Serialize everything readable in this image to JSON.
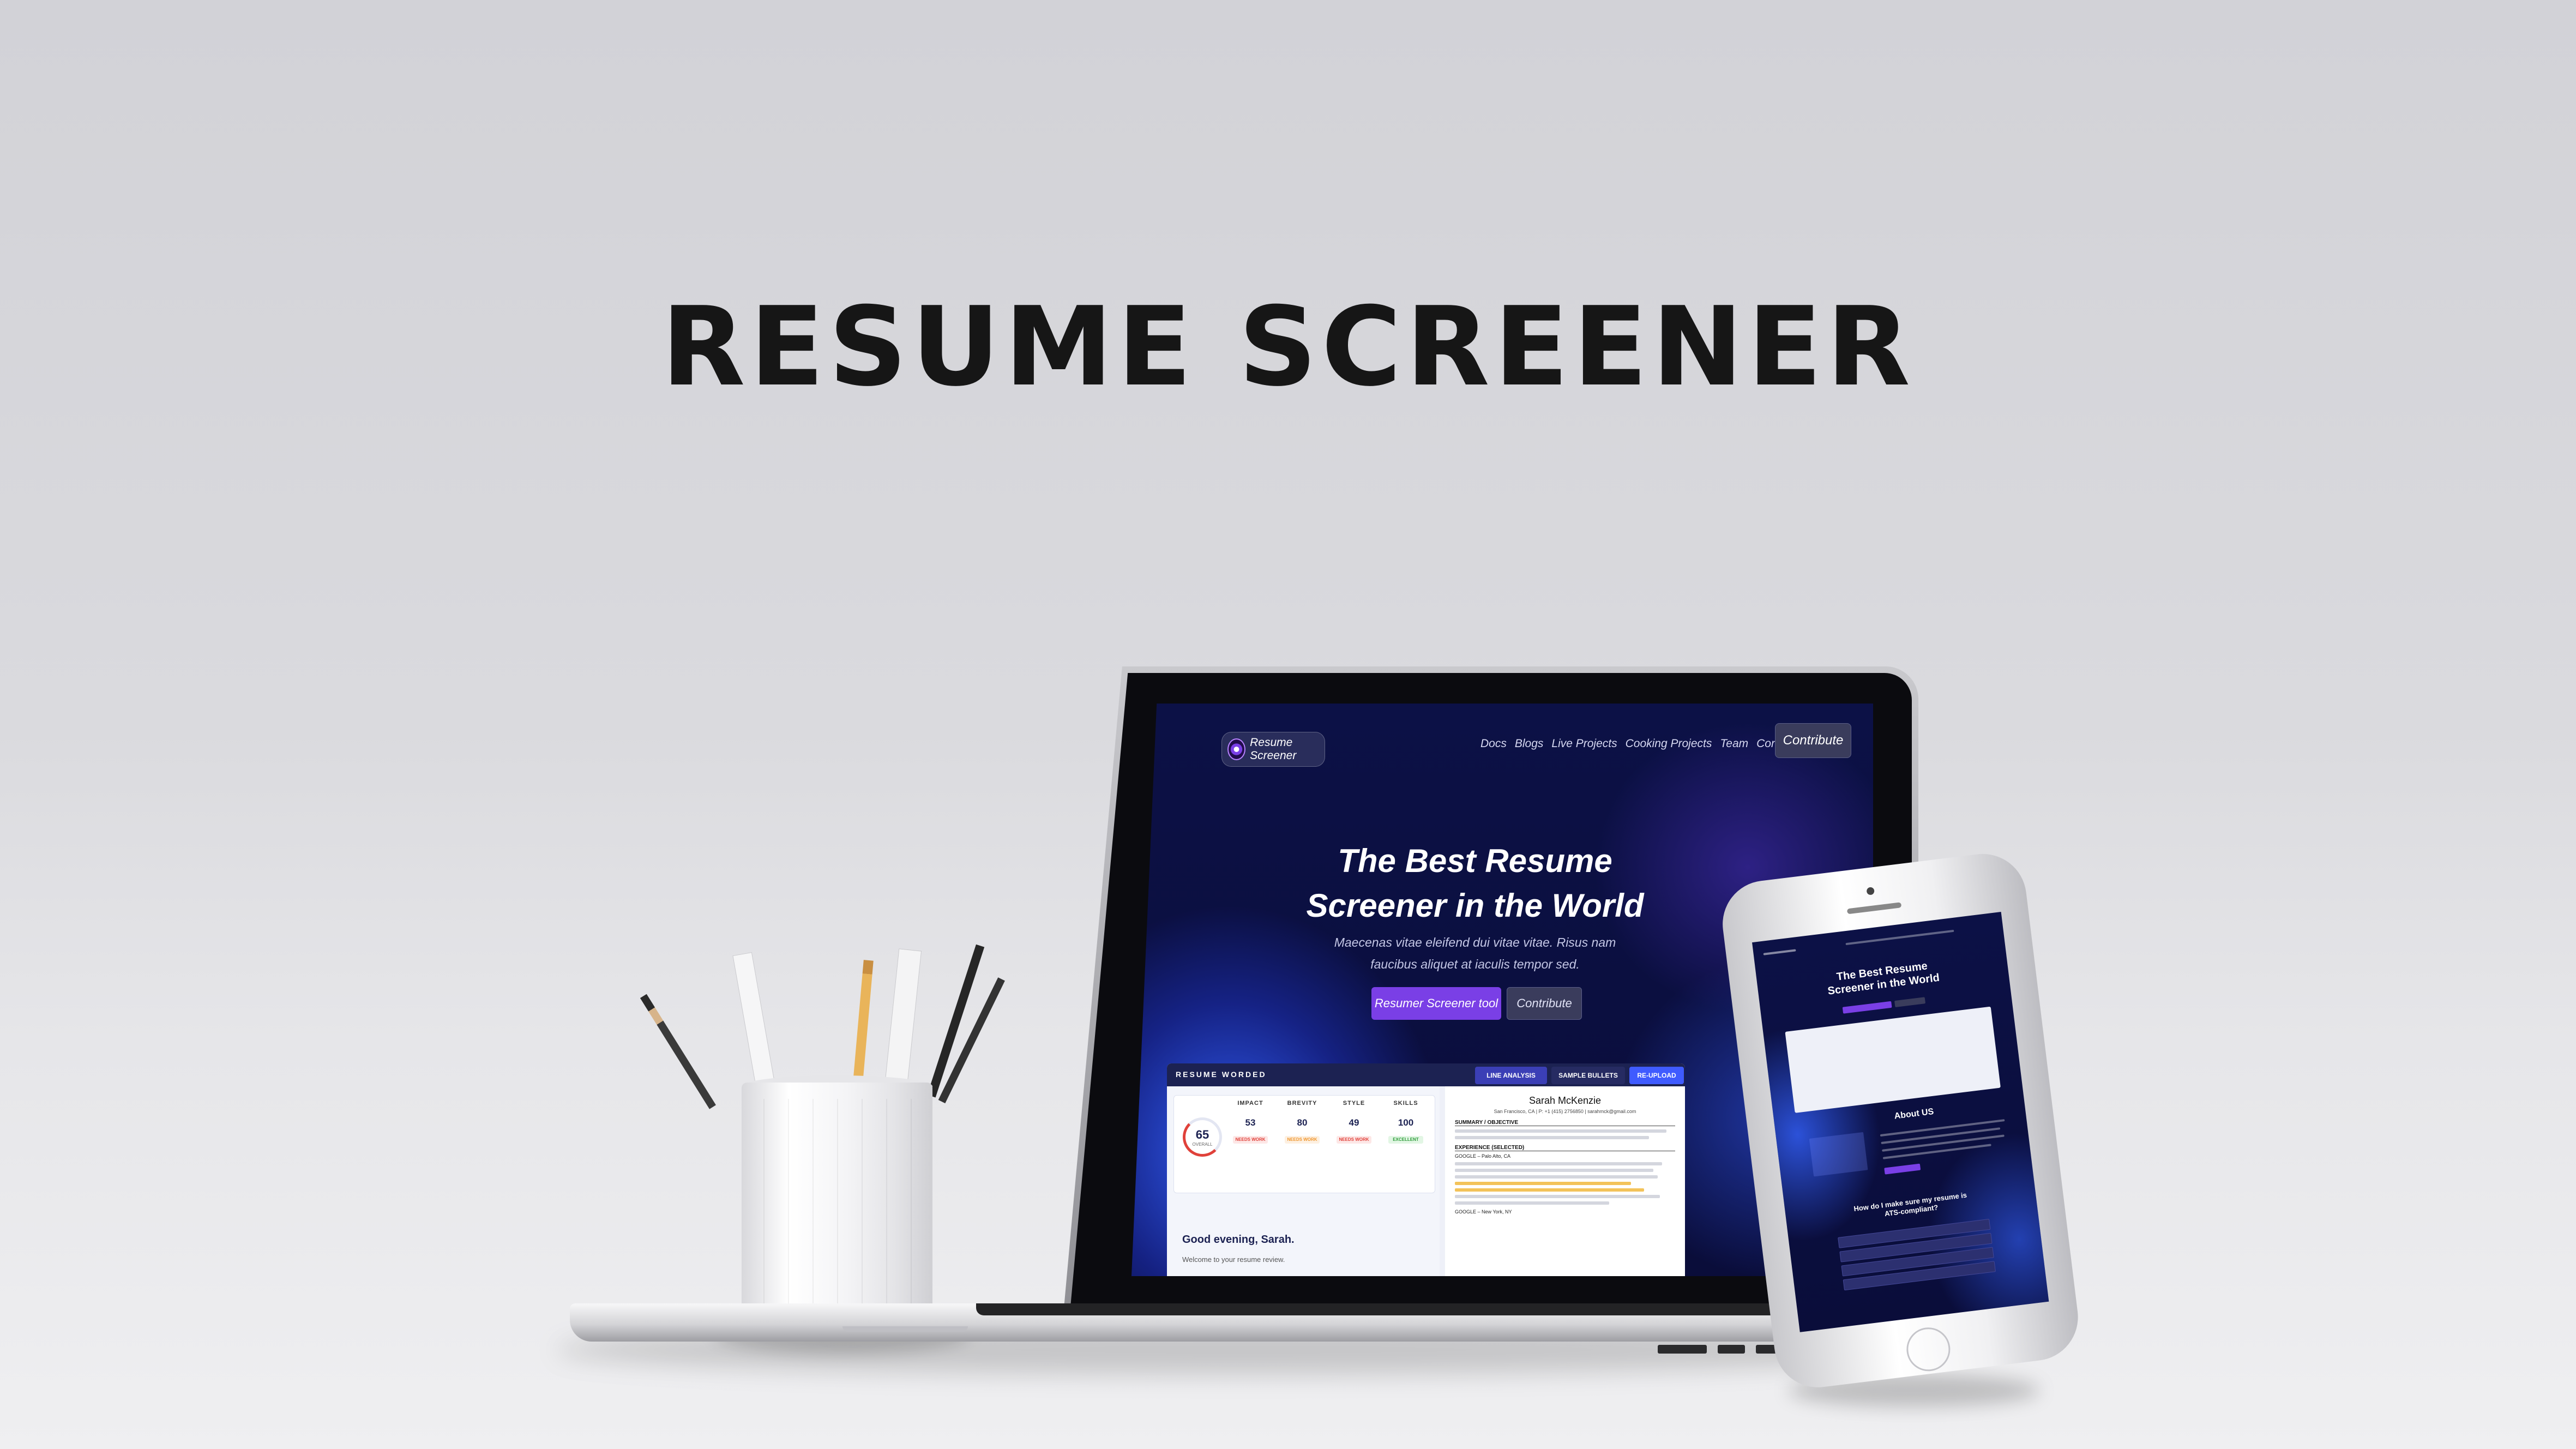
{
  "page": {
    "title": "RESUME SCREENER"
  },
  "laptop_site": {
    "logo_text": "Resume Screener",
    "nav_links": [
      "Docs",
      "Blogs",
      "Live Projects",
      "Cooking Projects",
      "Team",
      "Contact"
    ],
    "nav_cta": "Contribute",
    "hero_title_line1": "The Best Resume",
    "hero_title_line2": "Screener in the World",
    "hero_subtitle_line1": "Maecenas vitae eleifend dui vitae vitae. Risus nam",
    "hero_subtitle_line2": "faucibus aliquet at iaculis tempor sed.",
    "primary_button": "Resumer Screener tool",
    "secondary_button": "Contribute",
    "dashboard": {
      "brand": "RESUME WORDED",
      "tabs": [
        "LINE ANALYSIS",
        "SAMPLE BULLETS",
        "RE-UPLOAD"
      ],
      "overall_score": "65",
      "overall_label": "OVERALL",
      "metrics": [
        {
          "name": "IMPACT",
          "value": "53",
          "badge": "NEEDS WORK",
          "badge_color": "#e0413a"
        },
        {
          "name": "BREVITY",
          "value": "80",
          "badge": "NEEDS WORK",
          "badge_color": "#f0962e"
        },
        {
          "name": "STYLE",
          "value": "49",
          "badge": "NEEDS WORK",
          "badge_color": "#e0413a"
        },
        {
          "name": "SKILLS",
          "value": "100",
          "badge": "EXCELLENT",
          "badge_color": "#3cc84b"
        }
      ],
      "greeting": "Good evening, Sarah.",
      "welcome": "Welcome to your resume review.",
      "resume_name": "Sarah McKenzie",
      "resume_contact": "San Francisco, CA | P: +1 (415) 2756850 | sarahmck@gmail.com",
      "resume_section1": "SUMMARY / OBJECTIVE",
      "resume_section2": "EXPERIENCE (SELECTED)",
      "resume_company1": "GOOGLE – Palo Alto, CA",
      "resume_company2": "GOOGLE – New York, NY"
    }
  },
  "phone_site": {
    "hero_title_line1": "The Best Resume",
    "hero_title_line2": "Screener in the World",
    "about_heading": "About US",
    "faq_heading_line1": "How do I make sure my resume is",
    "faq_heading_line2": "ATS-compliant?"
  },
  "colors": {
    "accent": "#7a3fe6",
    "site_background": "#0a0d3a",
    "glow_blue": "#3462ff"
  }
}
